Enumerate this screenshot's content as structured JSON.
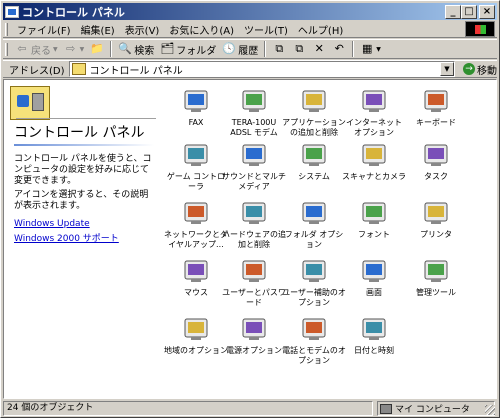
{
  "window": {
    "title": "コントロール パネル",
    "controls": {
      "minimize": "_",
      "maximize": "□",
      "close": "×"
    }
  },
  "menu": [
    "ファイル(F)",
    "編集(E)",
    "表示(V)",
    "お気に入り(A)",
    "ツール(T)",
    "ヘルプ(H)"
  ],
  "toolbar": {
    "back": "戻る",
    "search": "検索",
    "folders": "フォルダ",
    "history": "履歴"
  },
  "address": {
    "label": "アドレス(D)",
    "value": "コントロール パネル",
    "go": "移動"
  },
  "left_pane": {
    "title": "コントロール パネル",
    "description": "コントロール パネルを使うと、コンピュータの設定を好みに応じて変更できます。",
    "hint": "アイコンを選択すると、その説明が表示されます。",
    "links": [
      "Windows Update",
      "Windows 2000 サポート"
    ]
  },
  "items": [
    {
      "label": "FAX",
      "icon": "fax-icon"
    },
    {
      "label": "TERA-100U ADSL モデム",
      "icon": "modem-icon"
    },
    {
      "label": "アプリケーションの追加と削除",
      "icon": "add-remove-programs-icon"
    },
    {
      "label": "インターネット オプション",
      "icon": "internet-options-icon"
    },
    {
      "label": "キーボード",
      "icon": "keyboard-icon"
    },
    {
      "label": "ゲーム コントローラ",
      "icon": "game-controller-icon"
    },
    {
      "label": "サウンドとマルチメディア",
      "icon": "sound-icon"
    },
    {
      "label": "システム",
      "icon": "system-icon"
    },
    {
      "label": "スキャナとカメラ",
      "icon": "scanner-camera-icon"
    },
    {
      "label": "タスク",
      "icon": "scheduled-tasks-icon"
    },
    {
      "label": "ネットワークとダイヤルアップ...",
      "icon": "network-dialup-icon"
    },
    {
      "label": "ハードウェアの追加と削除",
      "icon": "add-hardware-icon"
    },
    {
      "label": "フォルダ オプション",
      "icon": "folder-options-icon"
    },
    {
      "label": "フォント",
      "icon": "fonts-icon"
    },
    {
      "label": "プリンタ",
      "icon": "printers-icon"
    },
    {
      "label": "マウス",
      "icon": "mouse-icon"
    },
    {
      "label": "ユーザーとパスワード",
      "icon": "users-passwords-icon"
    },
    {
      "label": "ユーザー補助のオプション",
      "icon": "accessibility-icon"
    },
    {
      "label": "画面",
      "icon": "display-icon"
    },
    {
      "label": "管理ツール",
      "icon": "admin-tools-icon"
    },
    {
      "label": "地域のオプション",
      "icon": "regional-options-icon"
    },
    {
      "label": "電源オプション",
      "icon": "power-options-icon"
    },
    {
      "label": "電話とモデムのオプション",
      "icon": "phone-modem-icon"
    },
    {
      "label": "日付と時刻",
      "icon": "date-time-icon"
    }
  ],
  "status": {
    "objects": "24 個のオブジェクト",
    "zone": "マイ コンピュータ"
  }
}
